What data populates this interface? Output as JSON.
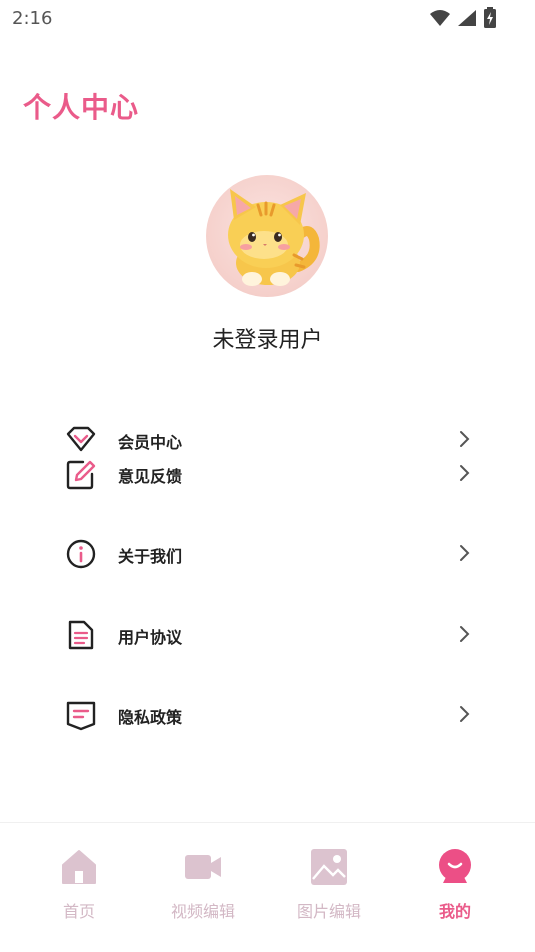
{
  "status": {
    "time": "2:16"
  },
  "header": {
    "title": "个人中心"
  },
  "profile": {
    "username": "未登录用户"
  },
  "menu": [
    {
      "label": "会员中心",
      "icon": "diamond-icon"
    },
    {
      "label": "意见反馈",
      "icon": "edit-icon"
    },
    {
      "label": "关于我们",
      "icon": "info-icon"
    },
    {
      "label": "用户协议",
      "icon": "document-icon"
    },
    {
      "label": "隐私政策",
      "icon": "message-icon"
    }
  ],
  "nav": [
    {
      "label": "首页",
      "icon": "home-icon",
      "active": false
    },
    {
      "label": "视频编辑",
      "icon": "video-camera-icon",
      "active": false
    },
    {
      "label": "图片编辑",
      "icon": "image-icon",
      "active": false
    },
    {
      "label": "我的",
      "icon": "profile-face-icon",
      "active": true
    }
  ],
  "colors": {
    "accent": "#ea5b8a",
    "inactive": "#d3b8c5"
  }
}
